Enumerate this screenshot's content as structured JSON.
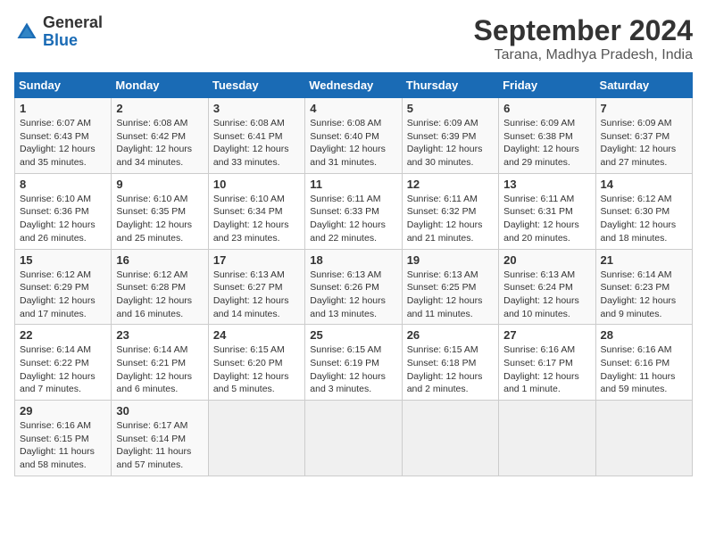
{
  "logo": {
    "general": "General",
    "blue": "Blue"
  },
  "title": "September 2024",
  "location": "Tarana, Madhya Pradesh, India",
  "days_of_week": [
    "Sunday",
    "Monday",
    "Tuesday",
    "Wednesday",
    "Thursday",
    "Friday",
    "Saturday"
  ],
  "weeks": [
    [
      {
        "day": "1",
        "sunrise": "Sunrise: 6:07 AM",
        "sunset": "Sunset: 6:43 PM",
        "daylight": "Daylight: 12 hours and 35 minutes."
      },
      {
        "day": "2",
        "sunrise": "Sunrise: 6:08 AM",
        "sunset": "Sunset: 6:42 PM",
        "daylight": "Daylight: 12 hours and 34 minutes."
      },
      {
        "day": "3",
        "sunrise": "Sunrise: 6:08 AM",
        "sunset": "Sunset: 6:41 PM",
        "daylight": "Daylight: 12 hours and 33 minutes."
      },
      {
        "day": "4",
        "sunrise": "Sunrise: 6:08 AM",
        "sunset": "Sunset: 6:40 PM",
        "daylight": "Daylight: 12 hours and 31 minutes."
      },
      {
        "day": "5",
        "sunrise": "Sunrise: 6:09 AM",
        "sunset": "Sunset: 6:39 PM",
        "daylight": "Daylight: 12 hours and 30 minutes."
      },
      {
        "day": "6",
        "sunrise": "Sunrise: 6:09 AM",
        "sunset": "Sunset: 6:38 PM",
        "daylight": "Daylight: 12 hours and 29 minutes."
      },
      {
        "day": "7",
        "sunrise": "Sunrise: 6:09 AM",
        "sunset": "Sunset: 6:37 PM",
        "daylight": "Daylight: 12 hours and 27 minutes."
      }
    ],
    [
      {
        "day": "8",
        "sunrise": "Sunrise: 6:10 AM",
        "sunset": "Sunset: 6:36 PM",
        "daylight": "Daylight: 12 hours and 26 minutes."
      },
      {
        "day": "9",
        "sunrise": "Sunrise: 6:10 AM",
        "sunset": "Sunset: 6:35 PM",
        "daylight": "Daylight: 12 hours and 25 minutes."
      },
      {
        "day": "10",
        "sunrise": "Sunrise: 6:10 AM",
        "sunset": "Sunset: 6:34 PM",
        "daylight": "Daylight: 12 hours and 23 minutes."
      },
      {
        "day": "11",
        "sunrise": "Sunrise: 6:11 AM",
        "sunset": "Sunset: 6:33 PM",
        "daylight": "Daylight: 12 hours and 22 minutes."
      },
      {
        "day": "12",
        "sunrise": "Sunrise: 6:11 AM",
        "sunset": "Sunset: 6:32 PM",
        "daylight": "Daylight: 12 hours and 21 minutes."
      },
      {
        "day": "13",
        "sunrise": "Sunrise: 6:11 AM",
        "sunset": "Sunset: 6:31 PM",
        "daylight": "Daylight: 12 hours and 20 minutes."
      },
      {
        "day": "14",
        "sunrise": "Sunrise: 6:12 AM",
        "sunset": "Sunset: 6:30 PM",
        "daylight": "Daylight: 12 hours and 18 minutes."
      }
    ],
    [
      {
        "day": "15",
        "sunrise": "Sunrise: 6:12 AM",
        "sunset": "Sunset: 6:29 PM",
        "daylight": "Daylight: 12 hours and 17 minutes."
      },
      {
        "day": "16",
        "sunrise": "Sunrise: 6:12 AM",
        "sunset": "Sunset: 6:28 PM",
        "daylight": "Daylight: 12 hours and 16 minutes."
      },
      {
        "day": "17",
        "sunrise": "Sunrise: 6:13 AM",
        "sunset": "Sunset: 6:27 PM",
        "daylight": "Daylight: 12 hours and 14 minutes."
      },
      {
        "day": "18",
        "sunrise": "Sunrise: 6:13 AM",
        "sunset": "Sunset: 6:26 PM",
        "daylight": "Daylight: 12 hours and 13 minutes."
      },
      {
        "day": "19",
        "sunrise": "Sunrise: 6:13 AM",
        "sunset": "Sunset: 6:25 PM",
        "daylight": "Daylight: 12 hours and 11 minutes."
      },
      {
        "day": "20",
        "sunrise": "Sunrise: 6:13 AM",
        "sunset": "Sunset: 6:24 PM",
        "daylight": "Daylight: 12 hours and 10 minutes."
      },
      {
        "day": "21",
        "sunrise": "Sunrise: 6:14 AM",
        "sunset": "Sunset: 6:23 PM",
        "daylight": "Daylight: 12 hours and 9 minutes."
      }
    ],
    [
      {
        "day": "22",
        "sunrise": "Sunrise: 6:14 AM",
        "sunset": "Sunset: 6:22 PM",
        "daylight": "Daylight: 12 hours and 7 minutes."
      },
      {
        "day": "23",
        "sunrise": "Sunrise: 6:14 AM",
        "sunset": "Sunset: 6:21 PM",
        "daylight": "Daylight: 12 hours and 6 minutes."
      },
      {
        "day": "24",
        "sunrise": "Sunrise: 6:15 AM",
        "sunset": "Sunset: 6:20 PM",
        "daylight": "Daylight: 12 hours and 5 minutes."
      },
      {
        "day": "25",
        "sunrise": "Sunrise: 6:15 AM",
        "sunset": "Sunset: 6:19 PM",
        "daylight": "Daylight: 12 hours and 3 minutes."
      },
      {
        "day": "26",
        "sunrise": "Sunrise: 6:15 AM",
        "sunset": "Sunset: 6:18 PM",
        "daylight": "Daylight: 12 hours and 2 minutes."
      },
      {
        "day": "27",
        "sunrise": "Sunrise: 6:16 AM",
        "sunset": "Sunset: 6:17 PM",
        "daylight": "Daylight: 12 hours and 1 minute."
      },
      {
        "day": "28",
        "sunrise": "Sunrise: 6:16 AM",
        "sunset": "Sunset: 6:16 PM",
        "daylight": "Daylight: 11 hours and 59 minutes."
      }
    ],
    [
      {
        "day": "29",
        "sunrise": "Sunrise: 6:16 AM",
        "sunset": "Sunset: 6:15 PM",
        "daylight": "Daylight: 11 hours and 58 minutes."
      },
      {
        "day": "30",
        "sunrise": "Sunrise: 6:17 AM",
        "sunset": "Sunset: 6:14 PM",
        "daylight": "Daylight: 11 hours and 57 minutes."
      },
      null,
      null,
      null,
      null,
      null
    ]
  ]
}
